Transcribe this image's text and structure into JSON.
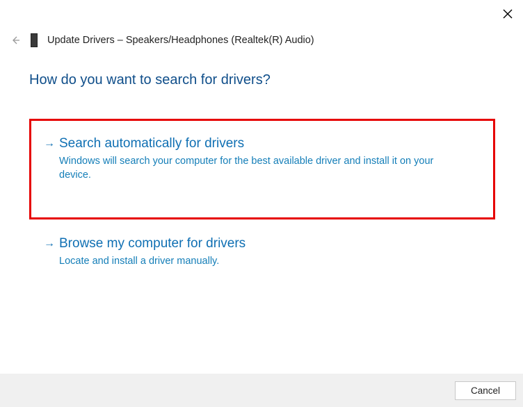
{
  "header": {
    "title": "Update Drivers – Speakers/Headphones (Realtek(R) Audio)"
  },
  "main": {
    "question": "How do you want to search for drivers?",
    "options": [
      {
        "title": "Search automatically for drivers",
        "description": "Windows will search your computer for the best available driver and install it on your device."
      },
      {
        "title": "Browse my computer for drivers",
        "description": "Locate and install a driver manually."
      }
    ]
  },
  "footer": {
    "cancel_label": "Cancel"
  }
}
